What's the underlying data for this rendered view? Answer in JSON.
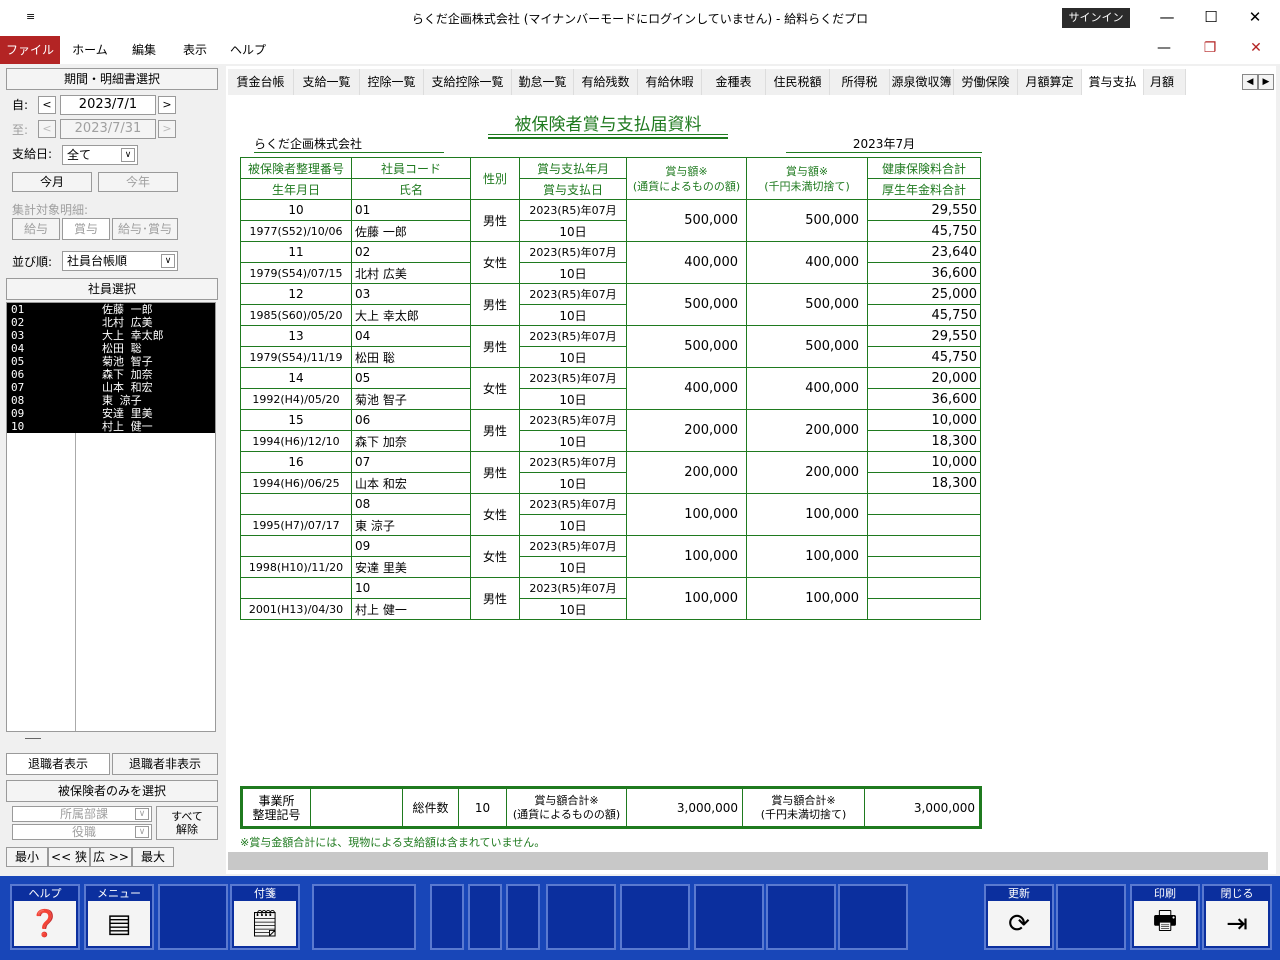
{
  "window": {
    "title": "らくだ企画株式会社 (マイナンバーモードにログインしていません) - 給料らくだプロ",
    "signin": "サインイン"
  },
  "menu": [
    "ファイル",
    "ホーム",
    "編集",
    "表示",
    "ヘルプ"
  ],
  "left": {
    "period_header": "期間・明細書選択",
    "from_label": "自:",
    "from_value": "2023/7/1",
    "to_label": "至:",
    "to_value": "2023/7/31",
    "payday_label": "支給日:",
    "payday_value": "全て",
    "this_month": "今月",
    "this_year": "今年",
    "summary_label": "集計対象明細:",
    "kind_salary": "給与",
    "kind_bonus": "賞与",
    "kind_both": "給与･賞与",
    "sort_label": "並び順:",
    "sort_value": "社員台帳順",
    "emp_header": "社員選択",
    "employees": [
      {
        "code": "01",
        "name": "佐藤 一郎"
      },
      {
        "code": "02",
        "name": "北村 広美"
      },
      {
        "code": "03",
        "name": "大上 幸太郎"
      },
      {
        "code": "04",
        "name": "松田 聡"
      },
      {
        "code": "05",
        "name": "菊池 智子"
      },
      {
        "code": "06",
        "name": "森下 加奈"
      },
      {
        "code": "07",
        "name": "山本 和宏"
      },
      {
        "code": "08",
        "name": "東 涼子"
      },
      {
        "code": "09",
        "name": "安達 里美"
      },
      {
        "code": "10",
        "name": "村上 健一"
      }
    ],
    "retired_show": "退職者表示",
    "retired_hide": "退職者非表示",
    "insured_only": "被保険者のみを選択",
    "dept_placeholder": "所属部課",
    "post_placeholder": "役職",
    "clear_all": "すべて\n解除",
    "min": "最小",
    "narrow": "<< 狭",
    "wide": "広 >>",
    "max": "最大"
  },
  "tabs": [
    "賃金台帳",
    "支給一覧",
    "控除一覧",
    "支給控除一覧",
    "勤怠一覧",
    "有給残数",
    "有給休暇",
    "金種表",
    "住民税額",
    "所得税",
    "源泉徴収簿",
    "労働保険",
    "月額算定",
    "賞与支払",
    "月額比較"
  ],
  "report": {
    "title": "被保険者賞与支払届資料",
    "company": "らくだ企画株式会社",
    "month": "2023年7月",
    "headers": {
      "h1a": "被保険者整理番号",
      "h1b": "生年月日",
      "h2a": "社員コード",
      "h2b": "氏名",
      "h3": "性別",
      "h4a": "賞与支払年月",
      "h4b": "賞与支払日",
      "h5": "賞与額※\n(通貨によるものの額)",
      "h6": "賞与額※\n(千円未満切捨て)",
      "h7a": "健康保険料合計",
      "h7b": "厚生年金料合計"
    },
    "rows": [
      {
        "no": "10",
        "birth": "1977(S52)/10/06",
        "code": "01",
        "name": "佐藤 一郎",
        "sex": "男性",
        "ym": "2023(R5)年07月",
        "day": "10日",
        "amt": "500,000",
        "amt2": "500,000",
        "health": "29,550",
        "pension": "45,750"
      },
      {
        "no": "11",
        "birth": "1979(S54)/07/15",
        "code": "02",
        "name": "北村 広美",
        "sex": "女性",
        "ym": "2023(R5)年07月",
        "day": "10日",
        "amt": "400,000",
        "amt2": "400,000",
        "health": "23,640",
        "pension": "36,600"
      },
      {
        "no": "12",
        "birth": "1985(S60)/05/20",
        "code": "03",
        "name": "大上 幸太郎",
        "sex": "男性",
        "ym": "2023(R5)年07月",
        "day": "10日",
        "amt": "500,000",
        "amt2": "500,000",
        "health": "25,000",
        "pension": "45,750"
      },
      {
        "no": "13",
        "birth": "1979(S54)/11/19",
        "code": "04",
        "name": "松田 聡",
        "sex": "男性",
        "ym": "2023(R5)年07月",
        "day": "10日",
        "amt": "500,000",
        "amt2": "500,000",
        "health": "29,550",
        "pension": "45,750"
      },
      {
        "no": "14",
        "birth": "1992(H4)/05/20",
        "code": "05",
        "name": "菊池 智子",
        "sex": "女性",
        "ym": "2023(R5)年07月",
        "day": "10日",
        "amt": "400,000",
        "amt2": "400,000",
        "health": "20,000",
        "pension": "36,600"
      },
      {
        "no": "15",
        "birth": "1994(H6)/12/10",
        "code": "06",
        "name": "森下 加奈",
        "sex": "男性",
        "ym": "2023(R5)年07月",
        "day": "10日",
        "amt": "200,000",
        "amt2": "200,000",
        "health": "10,000",
        "pension": "18,300"
      },
      {
        "no": "16",
        "birth": "1994(H6)/06/25",
        "code": "07",
        "name": "山本 和宏",
        "sex": "男性",
        "ym": "2023(R5)年07月",
        "day": "10日",
        "amt": "200,000",
        "amt2": "200,000",
        "health": "10,000",
        "pension": "18,300"
      },
      {
        "no": "",
        "birth": "1995(H7)/07/17",
        "code": "08",
        "name": "東 涼子",
        "sex": "女性",
        "ym": "2023(R5)年07月",
        "day": "10日",
        "amt": "100,000",
        "amt2": "100,000",
        "health": "",
        "pension": ""
      },
      {
        "no": "",
        "birth": "1998(H10)/11/20",
        "code": "09",
        "name": "安達 里美",
        "sex": "女性",
        "ym": "2023(R5)年07月",
        "day": "10日",
        "amt": "100,000",
        "amt2": "100,000",
        "health": "",
        "pension": ""
      },
      {
        "no": "",
        "birth": "2001(H13)/04/30",
        "code": "10",
        "name": "村上 健一",
        "sex": "男性",
        "ym": "2023(R5)年07月",
        "day": "10日",
        "amt": "100,000",
        "amt2": "100,000",
        "health": "",
        "pension": ""
      }
    ],
    "summary": {
      "office_label": "事業所\n整理記号",
      "office_value": "",
      "count_label": "総件数",
      "count_value": "10",
      "total1_label": "賞与額合計※\n(通貨によるものの額)",
      "total1_value": "3,000,000",
      "total2_label": "賞与額合計※\n(千円未満切捨て)",
      "total2_value": "3,000,000"
    },
    "note": "※賞与金額合計には、現物による支給額は含まれていません。"
  },
  "fkeys": [
    {
      "label": "ヘルプ",
      "icon": "help-icon"
    },
    {
      "label": "メニュー",
      "icon": "menu-icon"
    },
    {
      "label": "",
      "icon": ""
    },
    {
      "label": "付箋",
      "icon": "sticky-note-icon"
    },
    {
      "label": "",
      "icon": ""
    },
    {
      "label": "",
      "icon": ""
    },
    {
      "label": "",
      "icon": ""
    },
    {
      "label": "",
      "icon": ""
    },
    {
      "label": "",
      "icon": ""
    },
    {
      "label": "",
      "icon": ""
    },
    {
      "label": "",
      "icon": ""
    },
    {
      "label": "",
      "icon": ""
    },
    {
      "label": "",
      "icon": ""
    },
    {
      "label": "更新",
      "icon": "refresh-icon"
    },
    {
      "label": "",
      "icon": ""
    },
    {
      "label": "印刷",
      "icon": "printer-icon"
    },
    {
      "label": "閉じる",
      "icon": "exit-icon"
    }
  ]
}
